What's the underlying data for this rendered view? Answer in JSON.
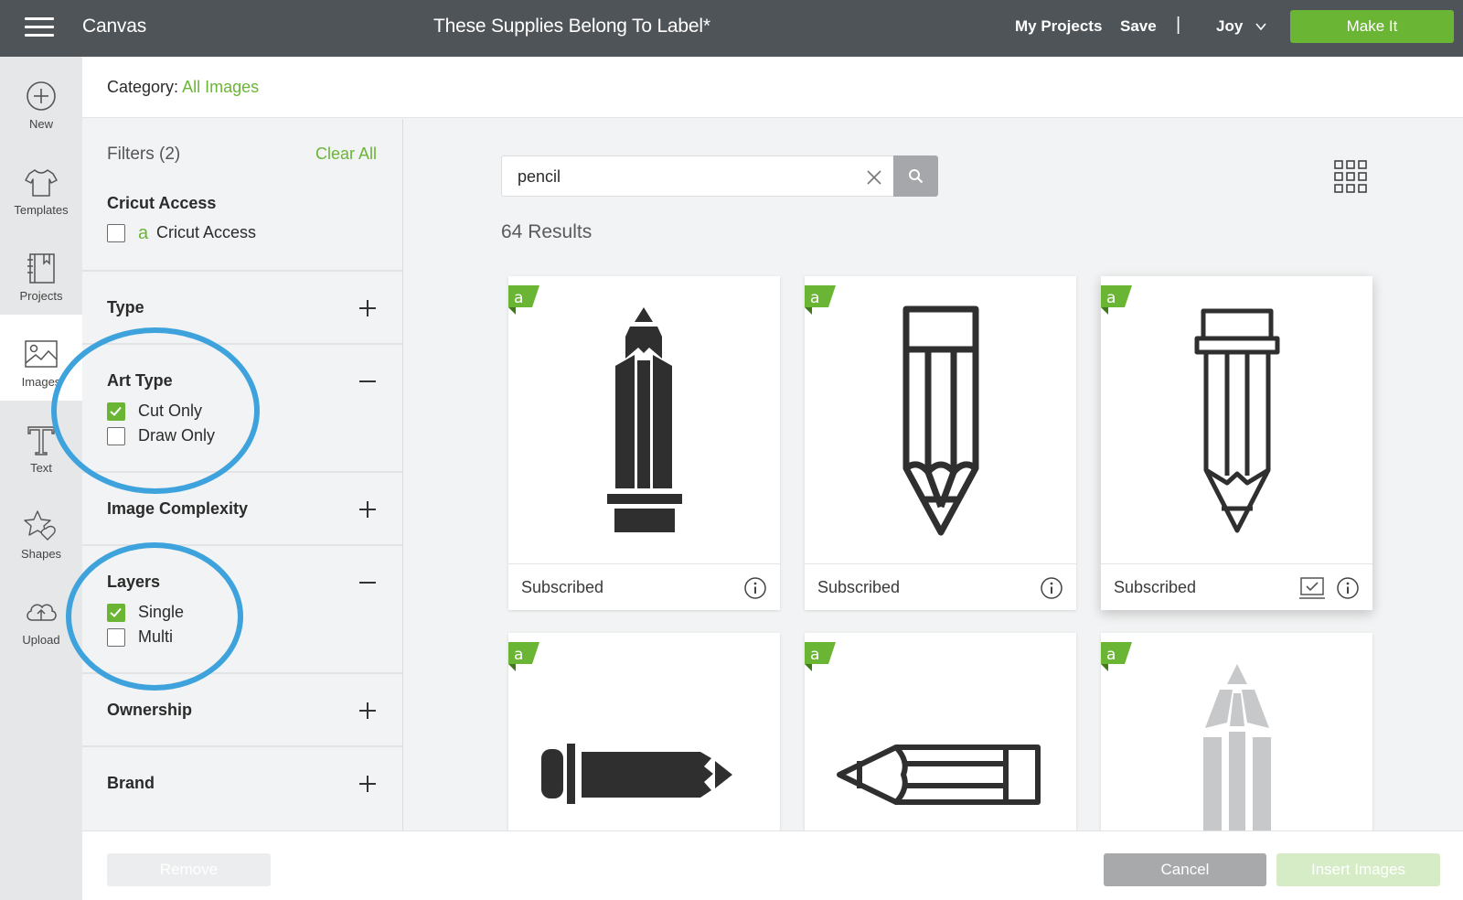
{
  "topbar": {
    "app_title": "Canvas",
    "project_title": "These Supplies Belong To Label*",
    "my_projects": "My Projects",
    "save": "Save",
    "separator": "|",
    "user": "Joy",
    "make_it": "Make It"
  },
  "leftnav": {
    "items": [
      {
        "label": "New",
        "icon": "plus-circle-icon"
      },
      {
        "label": "Templates",
        "icon": "tshirt-icon"
      },
      {
        "label": "Projects",
        "icon": "notebook-icon"
      },
      {
        "label": "Images",
        "icon": "image-icon",
        "active": true
      },
      {
        "label": "Text",
        "icon": "text-icon"
      },
      {
        "label": "Shapes",
        "icon": "shapes-icon"
      },
      {
        "label": "Upload",
        "icon": "cloud-upload-icon"
      }
    ]
  },
  "category": {
    "label": "Category:",
    "value": "All Images"
  },
  "filters": {
    "header": "Filters (2)",
    "clear_all": "Clear All",
    "sections": [
      {
        "title": "Cricut Access",
        "options": [
          {
            "label": "Cricut Access",
            "checked": false,
            "glyph": "a"
          }
        ]
      },
      {
        "title": "Type",
        "toggle": "+"
      },
      {
        "title": "Art Type",
        "toggle": "−",
        "options": [
          {
            "label": "Cut Only",
            "checked": true
          },
          {
            "label": "Draw Only",
            "checked": false
          }
        ]
      },
      {
        "title": "Image Complexity",
        "toggle": "+"
      },
      {
        "title": "Layers",
        "toggle": "−",
        "options": [
          {
            "label": "Single",
            "checked": true
          },
          {
            "label": "Multi",
            "checked": false
          }
        ]
      },
      {
        "title": "Ownership",
        "toggle": "+"
      },
      {
        "title": "Brand",
        "toggle": "+"
      }
    ]
  },
  "search": {
    "value": "pencil",
    "result_count": "64 Results"
  },
  "results": [
    {
      "status": "Subscribed",
      "badge": "a",
      "art": "solid-pencil-vertical"
    },
    {
      "status": "Subscribed",
      "badge": "a",
      "art": "outline-pencil-vertical"
    },
    {
      "status": "Subscribed",
      "badge": "a",
      "art": "outline-pencil-vertical-eraser",
      "selected_icon": true
    },
    {
      "status": "",
      "badge": "a",
      "art": "solid-pencil-horizontal"
    },
    {
      "status": "",
      "badge": "a",
      "art": "outline-pencil-horizontal"
    },
    {
      "status": "",
      "badge": "a",
      "art": "grey-pencil-vertical"
    }
  ],
  "bottombar": {
    "remove": "Remove",
    "cancel": "Cancel",
    "insert": "Insert Images"
  },
  "colors": {
    "accent_green": "#6bb535",
    "topbar": "#4f5458",
    "highlight_circle": "#3ea3dd"
  }
}
